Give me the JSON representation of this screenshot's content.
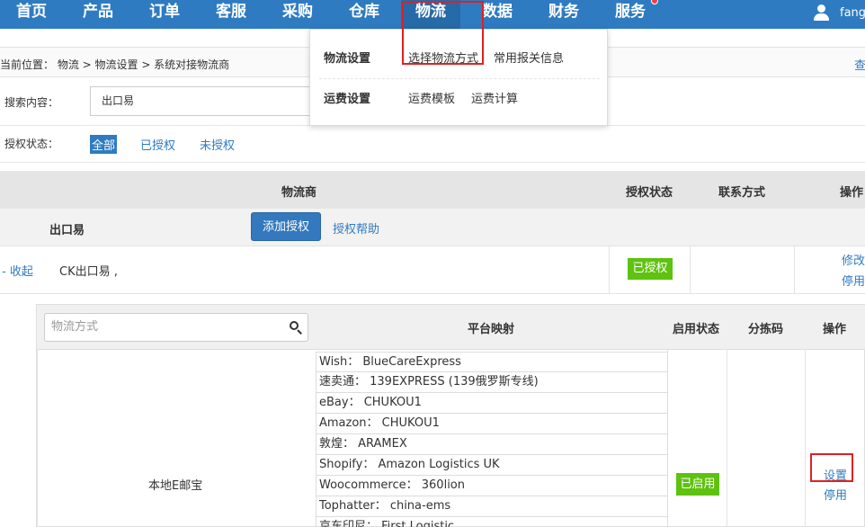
{
  "nav": {
    "items": [
      "首页",
      "产品",
      "订单",
      "客服",
      "采购",
      "仓库",
      "物流",
      "数据",
      "财务",
      "服务"
    ],
    "user": "fangj"
  },
  "dropdown": {
    "logistics_settings": "物流设置",
    "choose_method": "选择物流方式",
    "common_customs": "常用报关信息",
    "freight_settings": "运费设置",
    "freight_template": "运费模板",
    "freight_calc": "运费计算"
  },
  "breadcrumb": {
    "text": "当前位置： 物流 > 物流设置 > 系统对接物流商",
    "right_link": "查"
  },
  "search": {
    "label": "搜索内容：",
    "value": "出口易"
  },
  "auth_filter": {
    "label": "授权状态：",
    "options": [
      "全部",
      "已授权",
      "未授权"
    ]
  },
  "table": {
    "headers": {
      "provider": "物流商",
      "auth_status": "授权状态",
      "contact": "联系方式",
      "action": "操作"
    },
    "provider_row": {
      "name": "出口易",
      "add_auth": "添加授权",
      "auth_help": "授权帮助"
    },
    "account_row": {
      "collapse": "- 收起",
      "name": "CK出口易 ,",
      "status": "已授权",
      "edit": "修改",
      "disable": "停用"
    }
  },
  "inner": {
    "search_placeholder": "物流方式",
    "headers": {
      "platform_map": "平台映射",
      "enable_status": "启用状态",
      "sort_code": "分拣码",
      "action": "操作"
    },
    "service": {
      "name": "本地E邮宝",
      "mappings": [
        "Wish：  BlueCareExpress",
        "速卖通：  139EXPRESS (139俄罗斯专线)",
        "eBay：  CHUKOU1",
        "Amazon：  CHUKOU1",
        "敦煌：  ARAMEX",
        "Shopify：  Amazon Logistics UK",
        "Woocommerce：  360lion",
        "Tophatter：  china-ems",
        "京东印尼：  First Logistic"
      ],
      "status": "已启用",
      "settings": "设置",
      "disable": "停用"
    }
  },
  "colors": {
    "nav_blue": "#2f7bc1",
    "highlight_red": "#e02020",
    "badge_green": "#5ec20f"
  }
}
